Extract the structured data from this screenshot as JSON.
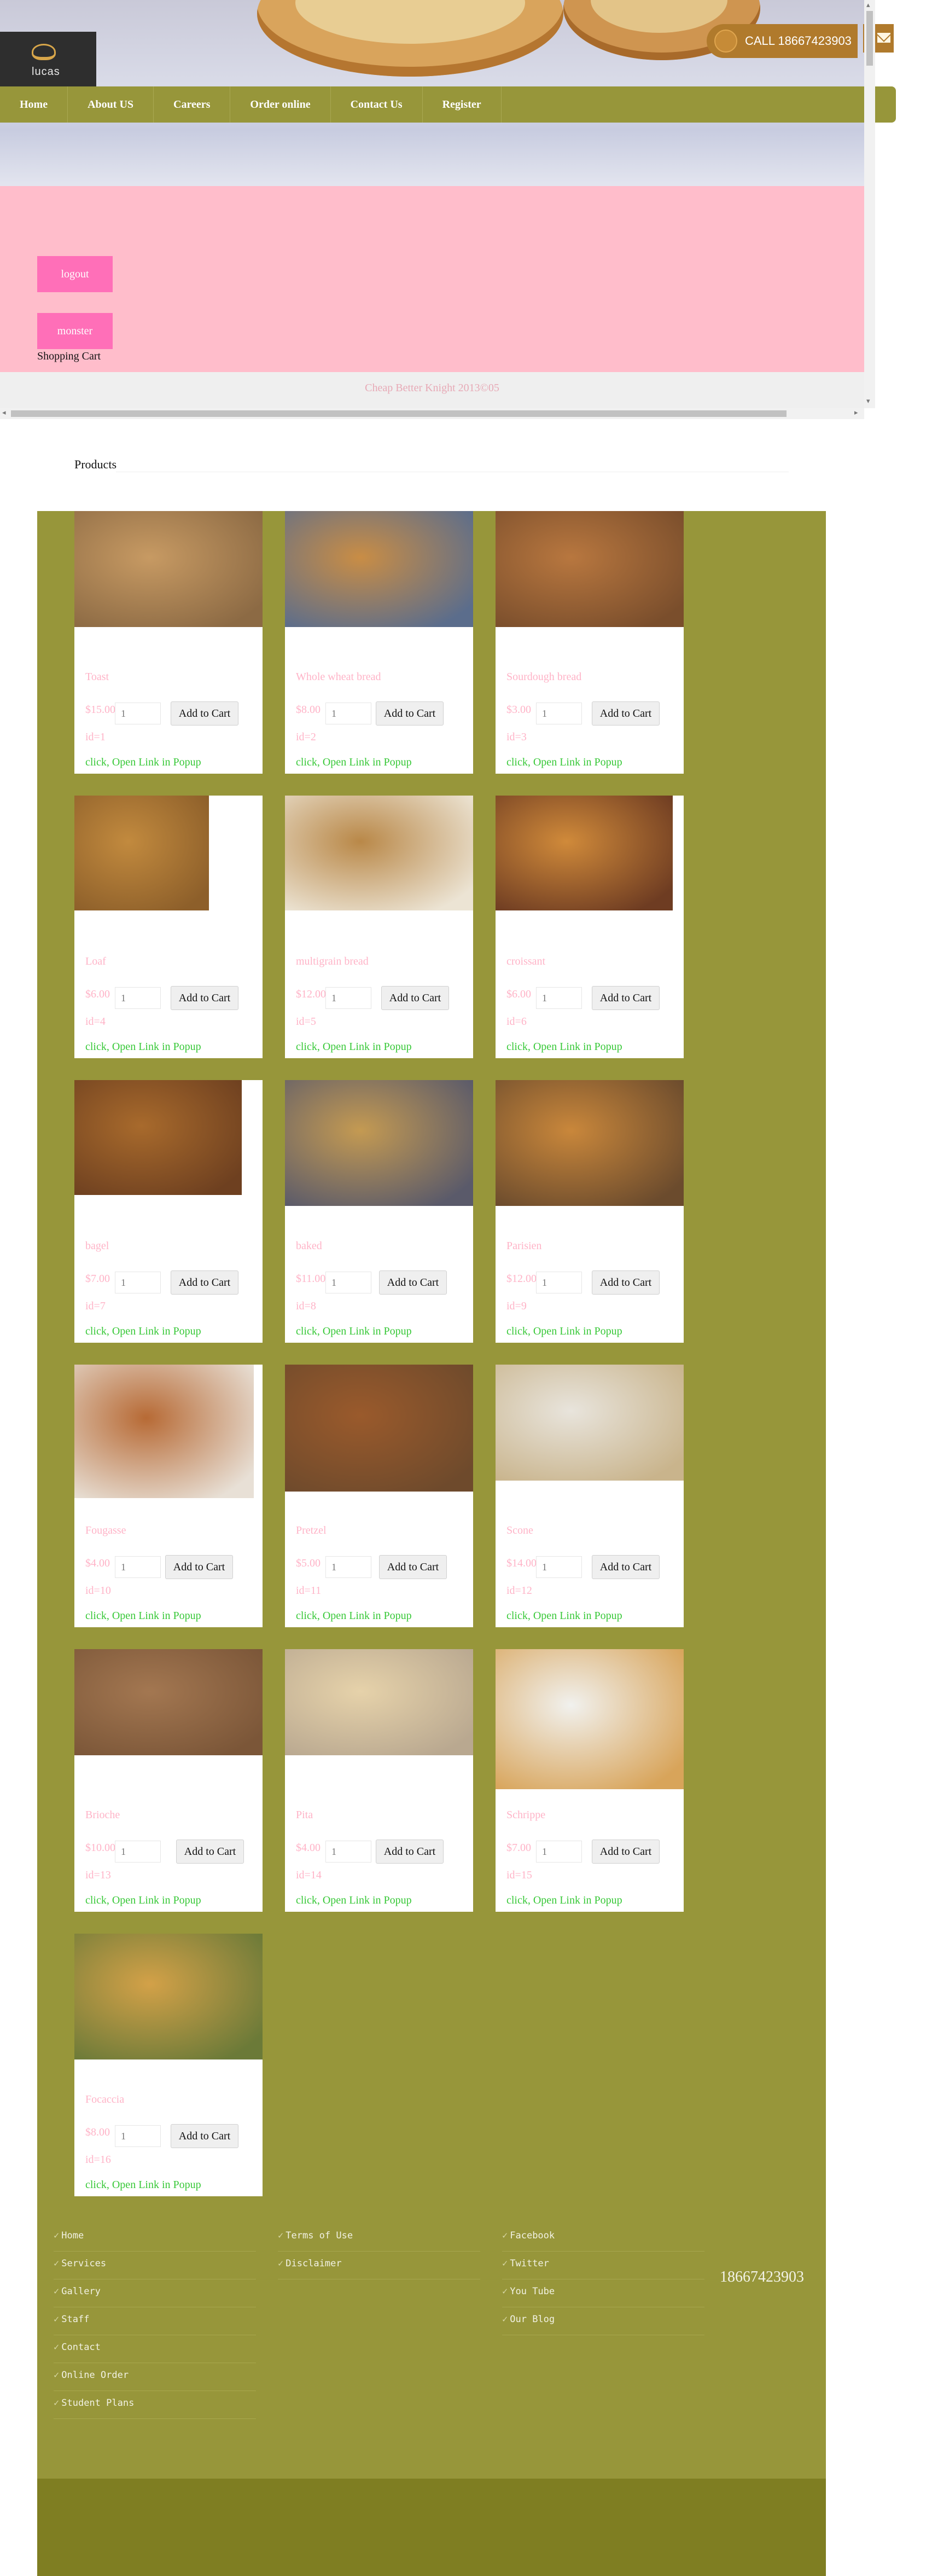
{
  "header": {
    "logo_text": "lucas",
    "call_text": "CALL  18667423903"
  },
  "nav": {
    "items": [
      "Home",
      "About US",
      "Careers",
      "Order online",
      "Contact Us",
      "Register"
    ]
  },
  "panel": {
    "logout_label": "logout",
    "monster_label": "monster",
    "cart_label": "Shopping Cart",
    "copyright": "Cheap Better Knight 2013©05"
  },
  "products": {
    "title": "Products",
    "add_label": "Add to Cart",
    "link_label": "click, Open Link in Popup",
    "qty_placeholder": "1",
    "items": [
      {
        "name": "Toast",
        "price": "$15.00",
        "id": "id=1"
      },
      {
        "name": "Whole wheat bread",
        "price": "$8.00",
        "id": "id=2"
      },
      {
        "name": "Sourdough bread",
        "price": "$3.00",
        "id": "id=3"
      },
      {
        "name": "Loaf",
        "price": "$6.00",
        "id": "id=4"
      },
      {
        "name": "multigrain bread",
        "price": "$12.00",
        "id": "id=5"
      },
      {
        "name": "croissant",
        "price": "$6.00",
        "id": "id=6"
      },
      {
        "name": "bagel",
        "price": "$7.00",
        "id": "id=7"
      },
      {
        "name": "baked",
        "price": "$11.00",
        "id": "id=8"
      },
      {
        "name": "Parisien",
        "price": "$12.00",
        "id": "id=9"
      },
      {
        "name": "Fougasse",
        "price": "$4.00",
        "id": "id=10"
      },
      {
        "name": "Pretzel",
        "price": "$5.00",
        "id": "id=11"
      },
      {
        "name": "Scone",
        "price": "$14.00",
        "id": "id=12"
      },
      {
        "name": "Brioche",
        "price": "$10.00",
        "id": "id=13"
      },
      {
        "name": "Pita",
        "price": "$4.00",
        "id": "id=14"
      },
      {
        "name": "Schrippe",
        "price": "$7.00",
        "id": "id=15"
      },
      {
        "name": "Focaccia",
        "price": "$8.00",
        "id": "id=16"
      }
    ]
  },
  "footer": {
    "col1": [
      "Home",
      "Services",
      "Gallery",
      "Staff",
      "Contact",
      "Online Order",
      "Student Plans"
    ],
    "col2": [
      "Terms of Use",
      "Disclaimer"
    ],
    "col3": [
      "Facebook",
      "Twitter",
      "You Tube",
      "Our Blog"
    ],
    "phone": "18667423903"
  },
  "colors": {
    "olive": "#97963a",
    "olive_dark": "#7f7e22",
    "pink_panel": "#ffbdcb",
    "pink_button": "#ff6fb8",
    "price_pink": "#ffb3c7",
    "link_green": "#37c837",
    "call_orange": "#b07a2c"
  }
}
